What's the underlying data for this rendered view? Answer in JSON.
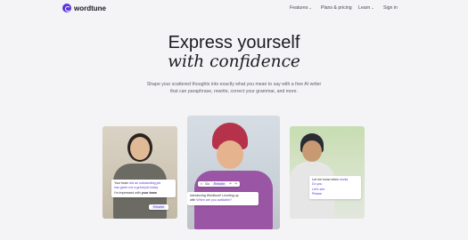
{
  "brand": {
    "name": "wordtune",
    "color": "#5a37d9"
  },
  "nav": {
    "features": "Features",
    "plans": "Plans & pricing",
    "learn": "Learn",
    "signin": "Sign in"
  },
  "hero": {
    "title_line1": "Express yourself",
    "title_line2": "with confidence",
    "subtitle": "Shape your scattered thoughts into exactly what you mean to say with a free AI writer that can paraphrase, rewrite, correct your grammar, and more."
  },
  "card1": {
    "line1_plain": "Your team ",
    "line1_struck": "did an outstanding job",
    "line2": "has given me a great job today",
    "line3": "I'm impressed with ",
    "line3_bold": "your team",
    "rewrite_label": "Rewrite"
  },
  "card2": {
    "tool1": "Go",
    "tool2": "Rewrite",
    "text1": "Introducing Wordtune! Leveling up",
    "text2": "with ",
    "text2_purple": "When are you available?"
  },
  "card3": {
    "line1": "Let me know when ",
    "line1_purple": "works",
    "line2": "Do you",
    "line3": "Let's see",
    "line4": "Please"
  }
}
